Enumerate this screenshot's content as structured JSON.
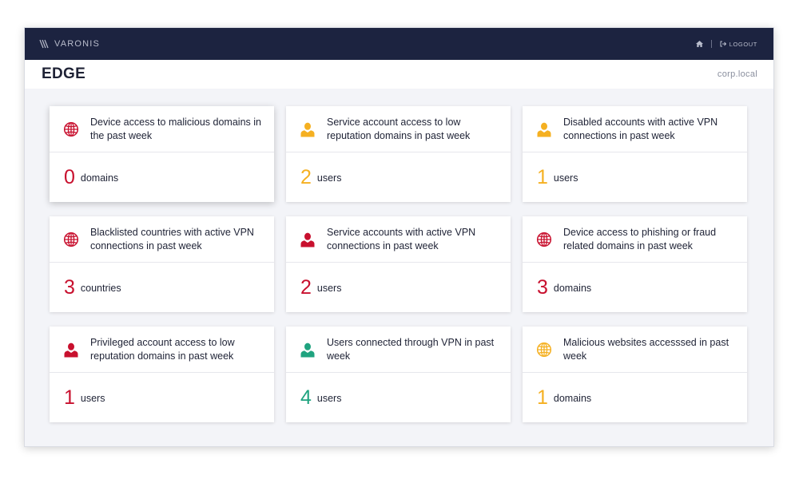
{
  "brand": "VARONIS",
  "nav": {
    "logout_label": "LOGOUT"
  },
  "header": {
    "title": "EDGE",
    "domain": "corp.local"
  },
  "colors": {
    "red": "#c8102e",
    "orange": "#f5b021",
    "teal": "#1fa37f",
    "navy": "#1c2340"
  },
  "cards": [
    {
      "title": "Device access to malicious domains in the past week",
      "count": "0",
      "unit": "domains",
      "icon": "globe-icon",
      "color": "#c8102e"
    },
    {
      "title": "Service account access to low reputation domains in past week",
      "count": "2",
      "unit": "users",
      "icon": "user-icon",
      "color": "#f5b021"
    },
    {
      "title": "Disabled accounts with active VPN connections in past week",
      "count": "1",
      "unit": "users",
      "icon": "user-icon",
      "color": "#f5b021"
    },
    {
      "title": "Blacklisted countries with active VPN connections in past week",
      "count": "3",
      "unit": "countries",
      "icon": "globe-icon",
      "color": "#c8102e"
    },
    {
      "title": "Service accounts with active VPN connections in past week",
      "count": "2",
      "unit": "users",
      "icon": "user-icon",
      "color": "#c8102e"
    },
    {
      "title": "Device access to phishing or fraud related domains in past week",
      "count": "3",
      "unit": "domains",
      "icon": "globe-icon",
      "color": "#c8102e"
    },
    {
      "title": "Privileged account access to low reputation domains in past week",
      "count": "1",
      "unit": "users",
      "icon": "user-icon",
      "color": "#c8102e"
    },
    {
      "title": "Users connected through VPN in past week",
      "count": "4",
      "unit": "users",
      "icon": "user-icon",
      "color": "#1fa37f"
    },
    {
      "title": "Malicious websites accesssed in past week",
      "count": "1",
      "unit": "domains",
      "icon": "globe-icon",
      "color": "#f5b021"
    }
  ]
}
